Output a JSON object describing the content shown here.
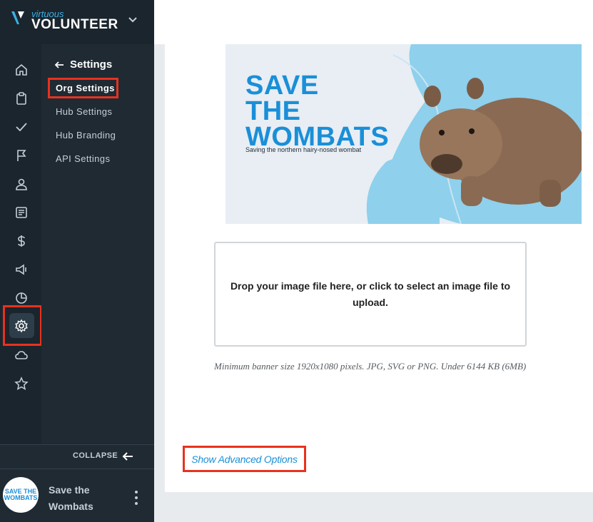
{
  "brand": {
    "small": "virtuous",
    "big": "VOLUNTEER"
  },
  "rail": {
    "icons": [
      "home-icon",
      "clipboard-icon",
      "check-icon",
      "flag-icon",
      "user-icon",
      "document-icon",
      "dollar-icon",
      "megaphone-icon",
      "pie-chart-icon",
      "gear-icon",
      "cloud-icon",
      "star-icon"
    ],
    "active": "gear-icon"
  },
  "subnav": {
    "title": "Settings",
    "items": [
      {
        "label": "Org Settings",
        "active": true
      },
      {
        "label": "Hub Settings",
        "active": false
      },
      {
        "label": "Hub Branding",
        "active": false
      },
      {
        "label": "API Settings",
        "active": false
      }
    ]
  },
  "collapse": {
    "label": "COLLAPSE"
  },
  "org": {
    "name": "Save the Wombats",
    "avatar_line1": "SAVE THE",
    "avatar_line2": "WOMBATS"
  },
  "banner": {
    "title_line1": "SAVE",
    "title_line2": "THE",
    "title_line3": "WOMBATS",
    "subtitle": "Saving the northern hairy-nosed wombat"
  },
  "upload": {
    "dropzone_text": "Drop your image file here, or click to select an image file to upload.",
    "hint": "Minimum banner size 1920x1080 pixels. JPG, SVG or PNG. Under 6144 KB (6MB)"
  },
  "advanced": {
    "label": "Show Advanced Options"
  },
  "colors": {
    "accent": "#1a8fd8",
    "sidebar": "#1f2a33",
    "highlight": "#e8321e"
  }
}
